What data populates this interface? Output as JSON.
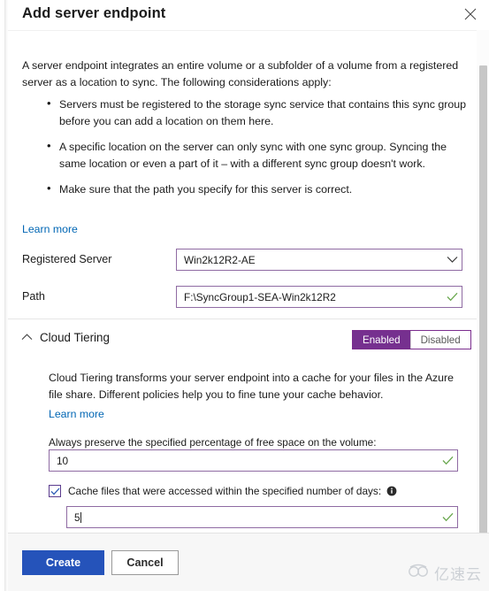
{
  "dialog": {
    "title": "Add server endpoint",
    "close_icon": "close-icon"
  },
  "intro": {
    "paragraph": "A server endpoint integrates an entire volume or a subfolder of a volume from a registered server as a location to sync. The following considerations apply:",
    "considerations": [
      "Servers must be registered to the storage sync service that contains this sync group before you can add a location on them here.",
      "A specific location on the server can only sync with one sync group. Syncing the same location or even a part of it – with a different sync group doesn't work.",
      "Make sure that the path you specify for this server is correct."
    ],
    "learn_more": "Learn more"
  },
  "form": {
    "registered_server": {
      "label": "Registered Server",
      "value": "Win2k12R2-AE",
      "chevron_icon": "chevron-down-icon"
    },
    "path": {
      "label": "Path",
      "value": "F:\\SyncGroup1-SEA-Win2k12R2",
      "valid_icon": "checkmark-icon"
    }
  },
  "cloud_tiering": {
    "caret_icon": "chevron-up-icon",
    "title": "Cloud Tiering",
    "toggle": {
      "enabled_label": "Enabled",
      "disabled_label": "Disabled",
      "selected": "Enabled"
    },
    "description": "Cloud Tiering transforms your server endpoint into a cache for your files in the Azure file share. Different policies help you to fine tune your cache behavior.",
    "learn_more": "Learn more",
    "free_space": {
      "label": "Always preserve the specified percentage of free space on the volume:",
      "value": "10",
      "valid_icon": "checkmark-icon"
    },
    "cache_days": {
      "checkbox_checked": true,
      "checkbox_icon": "checkmark-icon",
      "label": "Cache files that were accessed within the specified number of days:",
      "info_icon": "info-icon",
      "value": "5",
      "valid_icon": "checkmark-icon"
    }
  },
  "footer": {
    "create_label": "Create",
    "cancel_label": "Cancel"
  },
  "watermark": {
    "text": "亿速云",
    "logo_icon": "cloud-logo-icon"
  },
  "colors": {
    "accent_purple": "#76308f",
    "field_border": "#8f6ba3",
    "link_blue": "#0066b4",
    "primary_button": "#2553ba",
    "valid_green": "#6aa84f"
  }
}
